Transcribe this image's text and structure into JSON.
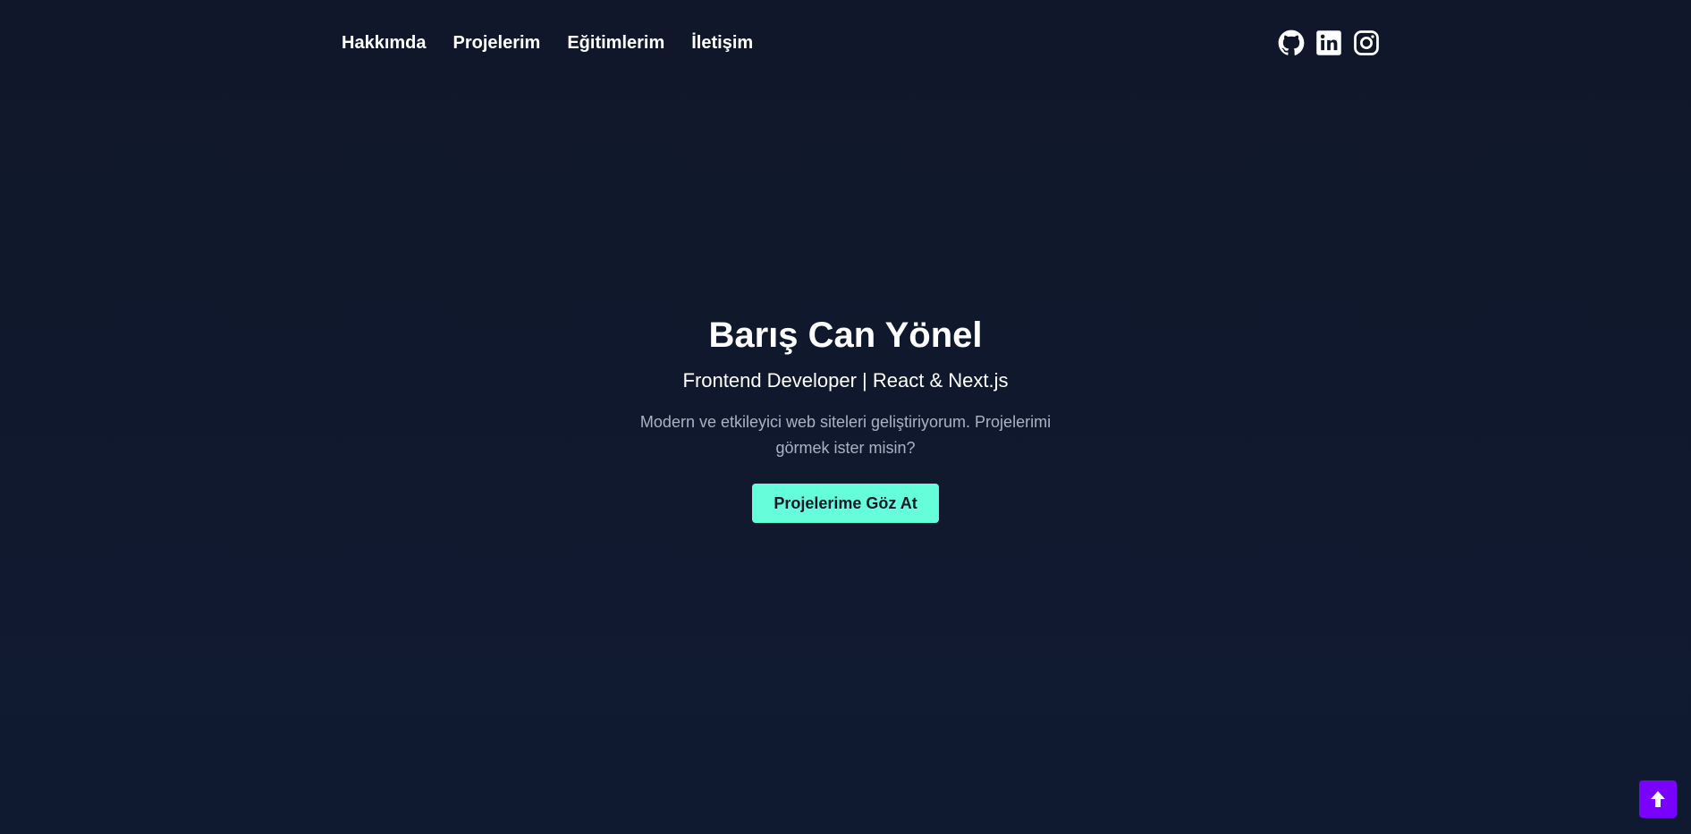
{
  "nav": {
    "links": [
      "Hakkımda",
      "Projelerim",
      "Eğitimlerim",
      "İletişim"
    ]
  },
  "social": {
    "icons": [
      "github-icon",
      "linkedin-icon",
      "instagram-icon"
    ]
  },
  "hero": {
    "name": "Barış Can Yönel",
    "role": "Frontend Developer | React & Next.js",
    "description": "Modern ve etkileyici web siteleri geliştiriyorum. Projelerimi görmek ister misin?",
    "cta_label": "Projelerime Göz At"
  },
  "scroll_top": {
    "icon": "arrow-up-icon"
  },
  "colors": {
    "background": "#11172a",
    "accent": "#64ffda",
    "scroll_button": "#7a00ff",
    "muted_text": "#aab3c5"
  }
}
